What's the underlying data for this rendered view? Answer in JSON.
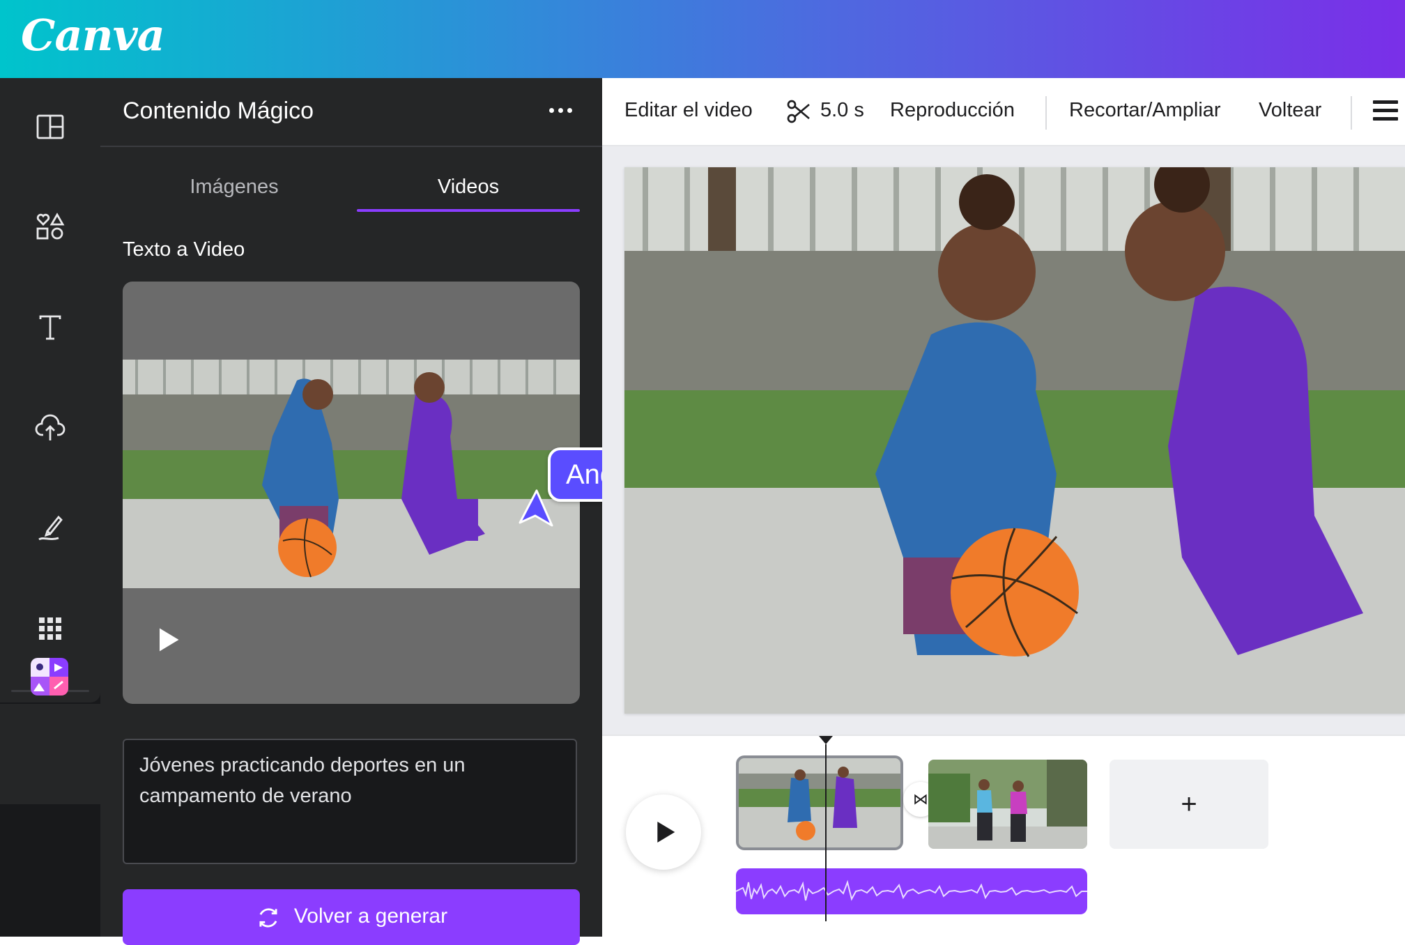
{
  "app": {
    "logo": "Canva"
  },
  "rail": {
    "items": [
      "layout-icon",
      "elements-icon",
      "text-icon",
      "upload-icon",
      "draw-icon",
      "apps-icon"
    ],
    "active_app": "magic-media-icon"
  },
  "panel": {
    "title": "Contenido Mágico",
    "tabs": [
      {
        "label": "Imágenes",
        "active": false
      },
      {
        "label": "Videos",
        "active": true
      }
    ],
    "section_label": "Texto a Video",
    "collaborator": "Andy",
    "prompt_value": "Jóvenes practicando deportes en un campamento de verano",
    "regenerate_label": "Volver a generar"
  },
  "toolbar": {
    "edit_video": "Editar el video",
    "duration": "5.0 s",
    "playback": "Reproducción",
    "crop": "Recortar/Ampliar",
    "flip": "Voltear"
  },
  "timeline": {
    "add_clip": "+",
    "transition_symbol": "⋈"
  },
  "colors": {
    "accent": "#8b3dff",
    "collaborator": "#5a4dff",
    "panel_bg": "#252627"
  }
}
